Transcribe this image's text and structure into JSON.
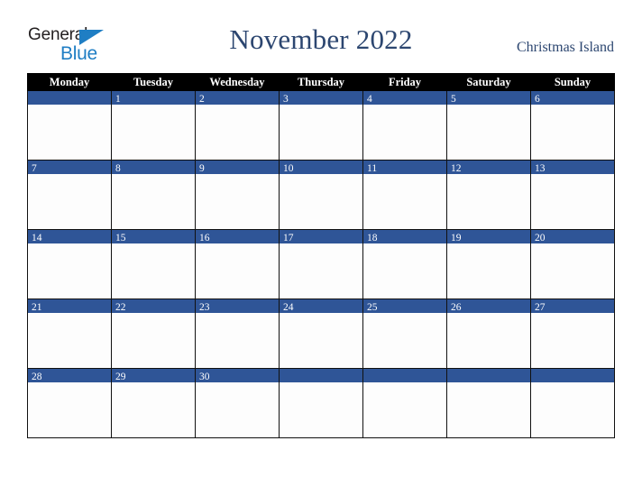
{
  "brand": {
    "name_part1": "General",
    "name_part2": "Blue",
    "triangle_icon": "triangle-icon",
    "color_dark": "#231f20",
    "color_blue": "#1f7ec4"
  },
  "header": {
    "title": "November 2022",
    "location": "Christmas Island",
    "title_color": "#2c4670"
  },
  "calendar": {
    "month": "November",
    "year": "2022",
    "weekday_headers": [
      "Monday",
      "Tuesday",
      "Wednesday",
      "Thursday",
      "Friday",
      "Saturday",
      "Sunday"
    ],
    "header_bg": "#000000",
    "header_fg": "#ffffff",
    "date_bar_color": "#2f5597",
    "date_text_color": "#ffffff",
    "cell_bg": "#fdfdfd",
    "grid_line_color": "#111111",
    "weeks": [
      {
        "days": [
          "",
          "1",
          "2",
          "3",
          "4",
          "5",
          "6"
        ]
      },
      {
        "days": [
          "7",
          "8",
          "9",
          "10",
          "11",
          "12",
          "13"
        ]
      },
      {
        "days": [
          "14",
          "15",
          "16",
          "17",
          "18",
          "19",
          "20"
        ]
      },
      {
        "days": [
          "21",
          "22",
          "23",
          "24",
          "25",
          "26",
          "27"
        ]
      },
      {
        "days": [
          "28",
          "29",
          "30",
          "",
          "",
          "",
          ""
        ]
      }
    ]
  }
}
